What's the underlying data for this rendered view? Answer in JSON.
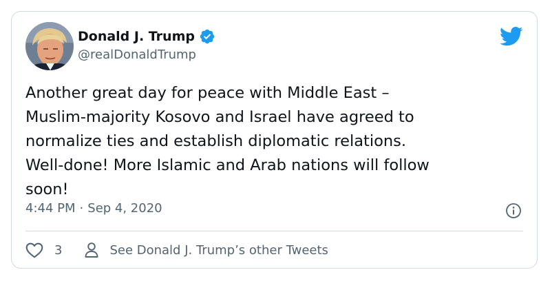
{
  "author": {
    "display_name": "Donald J. Trump",
    "handle": "@realDonaldTrump",
    "verified": true
  },
  "tweet": {
    "text": "Another great day for peace with Middle East –\nMuslim-majority Kosovo and Israel have agreed to\nnormalize ties and establish diplomatic relations.\nWell-done! More Islamic and Arab nations will follow\nsoon!",
    "time": "4:44 PM",
    "separator": "·",
    "date": "Sep 4, 2020"
  },
  "actions": {
    "like_count": "3",
    "see_other_label": "See Donald J. Trump’s other Tweets"
  },
  "icons": {
    "verified": "verified-badge-icon",
    "brand": "twitter-bird-icon",
    "info": "info-icon",
    "like": "heart-icon",
    "profile": "person-icon"
  },
  "colors": {
    "brand_blue": "#1d9bf0",
    "text_primary": "#0f1419",
    "text_secondary": "#536471",
    "border": "#cfd9de"
  }
}
